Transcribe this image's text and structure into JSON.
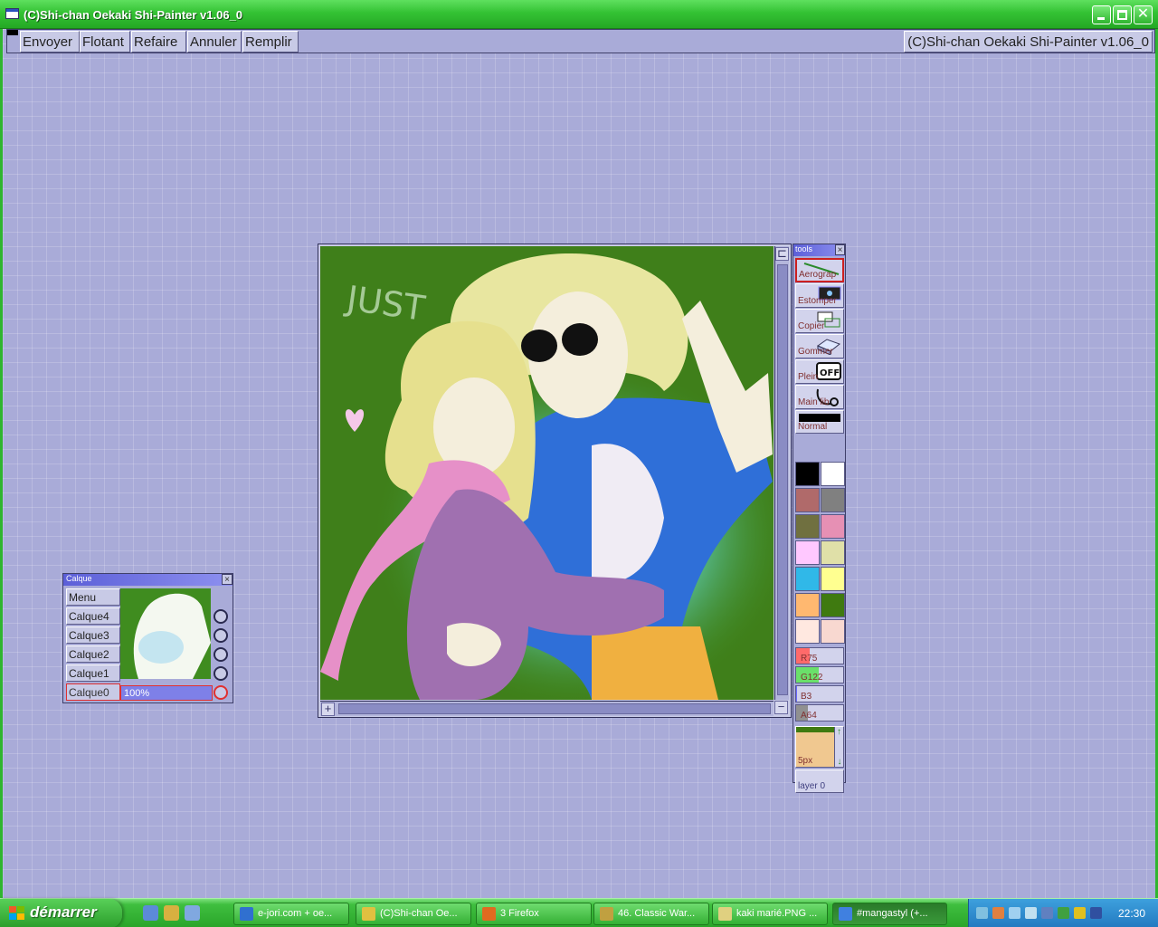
{
  "window": {
    "title": "(C)Shi-chan Oekaki Shi-Painter v1.06_0"
  },
  "menubar": {
    "items": [
      {
        "label": "Envoyer"
      },
      {
        "label": "Flotant"
      },
      {
        "label": "Refaire"
      },
      {
        "label": "Annuler"
      },
      {
        "label": "Remplir"
      }
    ],
    "app_label": "(C)Shi-chan Oekaki Shi-Painter v1.06_0"
  },
  "canvas": {
    "artwork_text": "JUST"
  },
  "tools": {
    "title": "tools",
    "items": [
      {
        "label": "Aerograp"
      },
      {
        "label": "Estomper"
      },
      {
        "label": "Copier"
      },
      {
        "label": "Gommer"
      },
      {
        "label": "Plein"
      },
      {
        "label": "Main lib"
      }
    ],
    "blend_mode": "Normal",
    "palette": [
      "#000000",
      "#ffffff",
      "#b06a6a",
      "#808080",
      "#707040",
      "#e690b4",
      "#ffc8ff",
      "#e0e0a8",
      "#30b8e8",
      "#ffff90",
      "#ffb870",
      "#3f7a10",
      "#ffe8e0",
      "#f8d8d0"
    ],
    "sliders": [
      {
        "label": "R75",
        "value": 75,
        "color": "#ff6a6a"
      },
      {
        "label": "G122",
        "value": 122,
        "color": "#6ae06a"
      },
      {
        "label": "B3",
        "value": 3,
        "color": "#6a6aff"
      },
      {
        "label": "A64",
        "value": 64,
        "color": "#909090"
      }
    ],
    "brush_size": "5px",
    "current_layer": "layer 0"
  },
  "layers": {
    "title": "Calque",
    "menu_label": "Menu",
    "items": [
      {
        "label": "Calque4"
      },
      {
        "label": "Calque3"
      },
      {
        "label": "Calque2"
      },
      {
        "label": "Calque1"
      },
      {
        "label": "Calque0"
      }
    ],
    "opacity": "100%"
  },
  "taskbar": {
    "start_label": "démarrer",
    "tasks": [
      {
        "label": "e-jori.com + oe...",
        "color": "#3070d0"
      },
      {
        "label": "(C)Shi-chan Oe...",
        "color": "#e0c040"
      },
      {
        "label": "3 Firefox",
        "color": "#e06a20"
      },
      {
        "label": "46. Classic War...",
        "color": "#c0a040"
      },
      {
        "label": "kaki marié.PNG ...",
        "color": "#e0d080"
      },
      {
        "label": "#mangastyl (+...",
        "color": "#4080e0"
      }
    ],
    "clock": "22:30"
  }
}
